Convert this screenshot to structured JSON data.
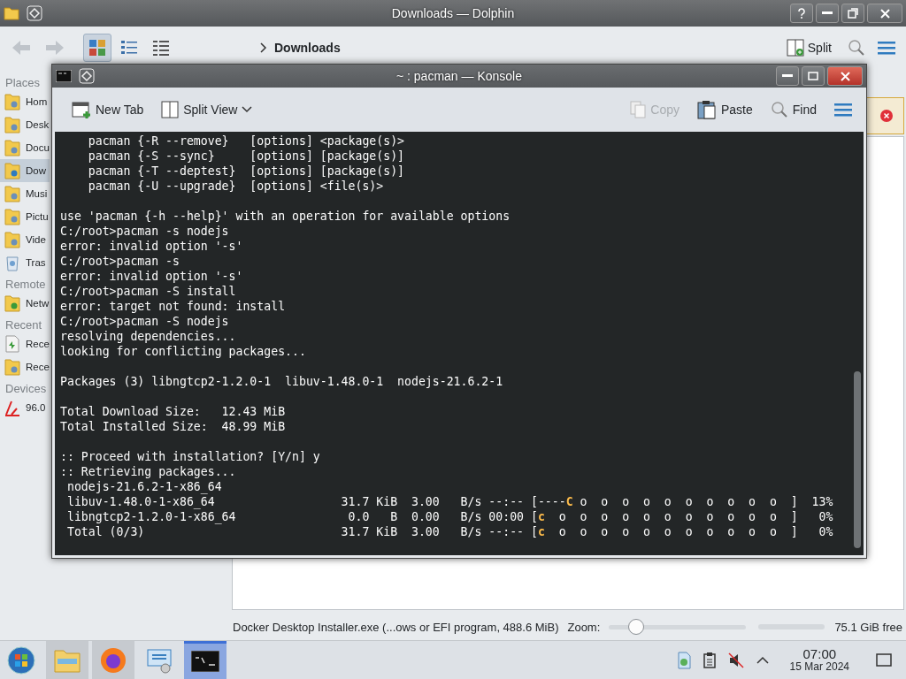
{
  "dolphin": {
    "title": "Downloads — Dolphin",
    "toolbar": {
      "view_modes": [
        {
          "kind": "icons",
          "selected": true
        },
        {
          "kind": "compact",
          "selected": false
        },
        {
          "kind": "details",
          "selected": false
        }
      ],
      "location": "Downloads",
      "split_label": "Split"
    },
    "sidebar": [
      {
        "title": "Places",
        "items": [
          {
            "label": "Hom",
            "kind": "home",
            "selected": false
          },
          {
            "label": "Desk",
            "kind": "desktop",
            "selected": false
          },
          {
            "label": "Docu",
            "kind": "document",
            "selected": false
          },
          {
            "label": "Dow",
            "kind": "download",
            "selected": true
          },
          {
            "label": "Musi",
            "kind": "music",
            "selected": false
          },
          {
            "label": "Pictu",
            "kind": "pictures",
            "selected": false
          },
          {
            "label": "Vide",
            "kind": "video",
            "selected": false
          },
          {
            "label": "Tras",
            "kind": "trash",
            "selected": false
          }
        ]
      },
      {
        "title": "Remote",
        "items": [
          {
            "label": "Netw",
            "kind": "network",
            "selected": false
          }
        ]
      },
      {
        "title": "Recent",
        "items": [
          {
            "label": "Rece",
            "kind": "recent-files",
            "selected": false
          },
          {
            "label": "Rece",
            "kind": "recent-locations",
            "selected": false
          }
        ]
      },
      {
        "title": "Devices",
        "items": [
          {
            "label": "96.0",
            "kind": "drive",
            "selected": false
          }
        ]
      }
    ],
    "status_bar": {
      "file_info": "Docker Desktop Installer.exe (...ows or EFI program, 488.6 MiB)",
      "zoom_label": "Zoom:",
      "zoom": {
        "level": 0.2
      },
      "free_space": "75.1 GiB free"
    }
  },
  "konsole": {
    "title": "~ : pacman — Konsole",
    "toolbar": [
      {
        "kind": "new-tab",
        "label": "New Tab",
        "disabled": false
      },
      {
        "kind": "split-view",
        "label": "Split View",
        "disabled": false
      },
      {
        "kind": "copy",
        "label": "Copy",
        "disabled": true
      },
      {
        "kind": "paste",
        "label": "Paste",
        "disabled": false
      },
      {
        "kind": "find",
        "label": "Find",
        "disabled": false
      }
    ],
    "lines": [
      {
        "kind": "text",
        "text": "    pacman {-R --remove}   [options] <package(s)>"
      },
      {
        "kind": "text",
        "text": "    pacman {-S --sync}     [options] [package(s)]"
      },
      {
        "kind": "text",
        "text": "    pacman {-T --deptest}  [options] [package(s)]"
      },
      {
        "kind": "text",
        "text": "    pacman {-U --upgrade}  [options] <file(s)>"
      },
      {
        "kind": "blank"
      },
      {
        "kind": "text",
        "text": "use 'pacman {-h --help}' with an operation for available options"
      },
      {
        "kind": "text",
        "text": "C:/root>pacman -s nodejs"
      },
      {
        "kind": "text",
        "text": "error: invalid option '-s'"
      },
      {
        "kind": "text",
        "text": "C:/root>pacman -s"
      },
      {
        "kind": "text",
        "text": "error: invalid option '-s'"
      },
      {
        "kind": "text",
        "text": "C:/root>pacman -S install"
      },
      {
        "kind": "text",
        "text": "error: target not found: install"
      },
      {
        "kind": "text",
        "text": "C:/root>pacman -S nodejs"
      },
      {
        "kind": "text",
        "text": "resolving dependencies..."
      },
      {
        "kind": "text",
        "text": "looking for conflicting packages..."
      },
      {
        "kind": "blank"
      },
      {
        "kind": "text",
        "text": "Packages (3) libngtcp2-1.2.0-1  libuv-1.48.0-1  nodejs-21.6.2-1"
      },
      {
        "kind": "blank"
      },
      {
        "kind": "text",
        "text": "Total Download Size:   12.43 MiB"
      },
      {
        "kind": "text",
        "text": "Total Installed Size:  48.99 MiB"
      },
      {
        "kind": "blank"
      },
      {
        "kind": "text",
        "text": ":: Proceed with installation? [Y/n] y"
      },
      {
        "kind": "text",
        "text": ":: Retrieving packages..."
      },
      {
        "kind": "text",
        "text": " nodejs-21.6.2-1-x86_64"
      },
      {
        "kind": "progress",
        "before": " libuv-1.48.0-1-x86_64                  31.7 KiB  3.00   B/s --:-- [----",
        "pacman": "C",
        "after": " o  o  o  o  o  o  o  o  o  o  ]  13%"
      },
      {
        "kind": "progress",
        "before": " libngtcp2-1.2.0-1-x86_64                0.0   B  0.00   B/s 00:00 [",
        "pacman": "c",
        "after": "  o  o  o  o  o  o  o  o  o  o  o  ]   0%"
      },
      {
        "kind": "progress",
        "before": " Total (0/3)                            31.7 KiB  3.00   B/s --:-- [",
        "pacman": "c",
        "after": "  o  o  o  o  o  o  o  o  o  o  o  ]   0%"
      }
    ]
  },
  "taskbar": {
    "apps": [
      {
        "kind": "start",
        "running": false,
        "selected": false
      },
      {
        "kind": "files",
        "running": true,
        "selected": false
      },
      {
        "kind": "browser",
        "running": true,
        "selected": false
      },
      {
        "kind": "network",
        "running": false,
        "selected": false
      },
      {
        "kind": "terminal",
        "running": true,
        "selected": true
      }
    ],
    "tray": [
      {
        "kind": "updates"
      },
      {
        "kind": "clipboard"
      },
      {
        "kind": "volume-muted"
      },
      {
        "kind": "expand"
      }
    ],
    "clock": {
      "time": "07:00",
      "date": "15 Mar 2024"
    }
  }
}
